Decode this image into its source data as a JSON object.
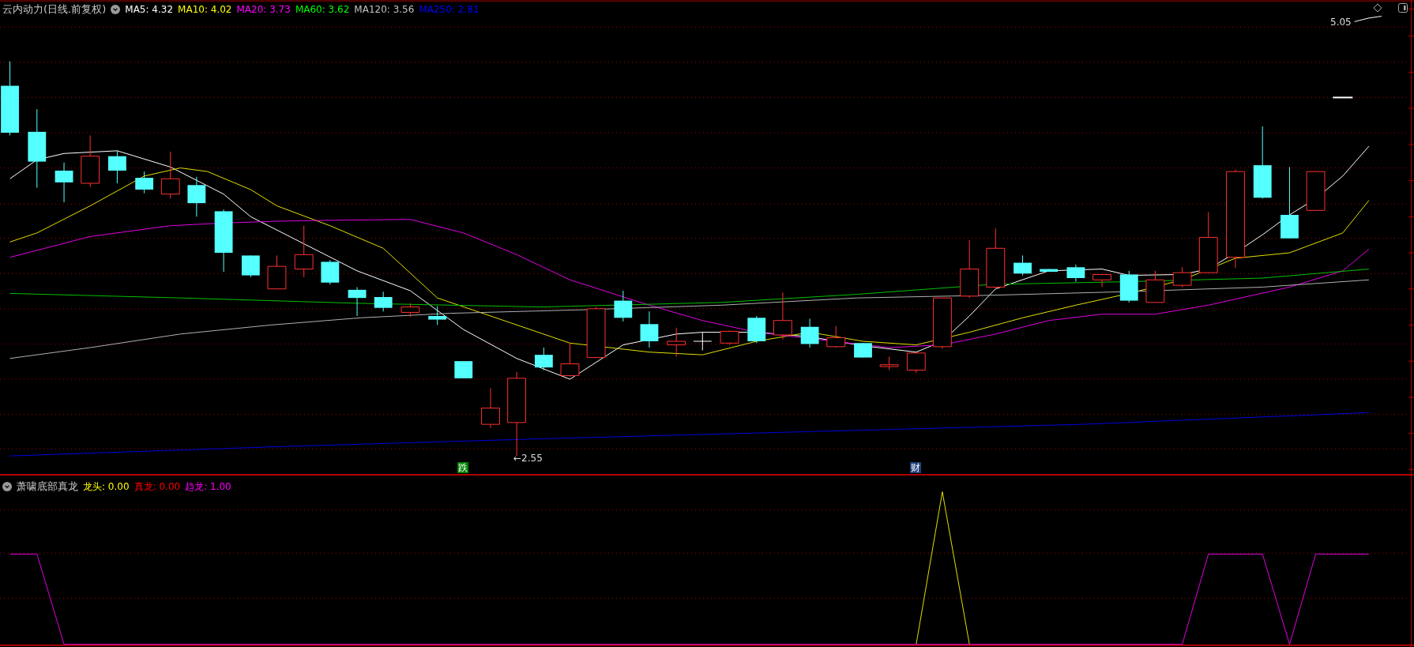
{
  "main_chart": {
    "title": "云内动力(日线.前复权)",
    "moving_averages": [
      {
        "label": "MA5:",
        "value": "4.32",
        "color": "#ffffff"
      },
      {
        "label": "MA10:",
        "value": "4.02",
        "color": "#ffff00"
      },
      {
        "label": "MA20:",
        "value": "3.73",
        "color": "#ff00ff"
      },
      {
        "label": "MA60:",
        "value": "3.62",
        "color": "#00ff00"
      },
      {
        "label": "MA120:",
        "value": "3.56",
        "color": "#c0c0c0"
      },
      {
        "label": "MA250:",
        "value": "2.81",
        "color": "#0000ff"
      }
    ],
    "high_label": "5.05",
    "low_label": "←2.55",
    "signals": [
      {
        "text": "跌",
        "color": "#008000"
      },
      {
        "text": "财",
        "color": "#1e3f78"
      }
    ]
  },
  "indicator": {
    "title": "萧啸底部真龙",
    "values": [
      {
        "label": "龙头:",
        "value": "0.00",
        "color": "#ffff00"
      },
      {
        "label": "真龙:",
        "value": "0.00",
        "color": "#ff0000"
      },
      {
        "label": "趋龙:",
        "value": "1.00",
        "color": "#ff00ff"
      }
    ]
  }
}
